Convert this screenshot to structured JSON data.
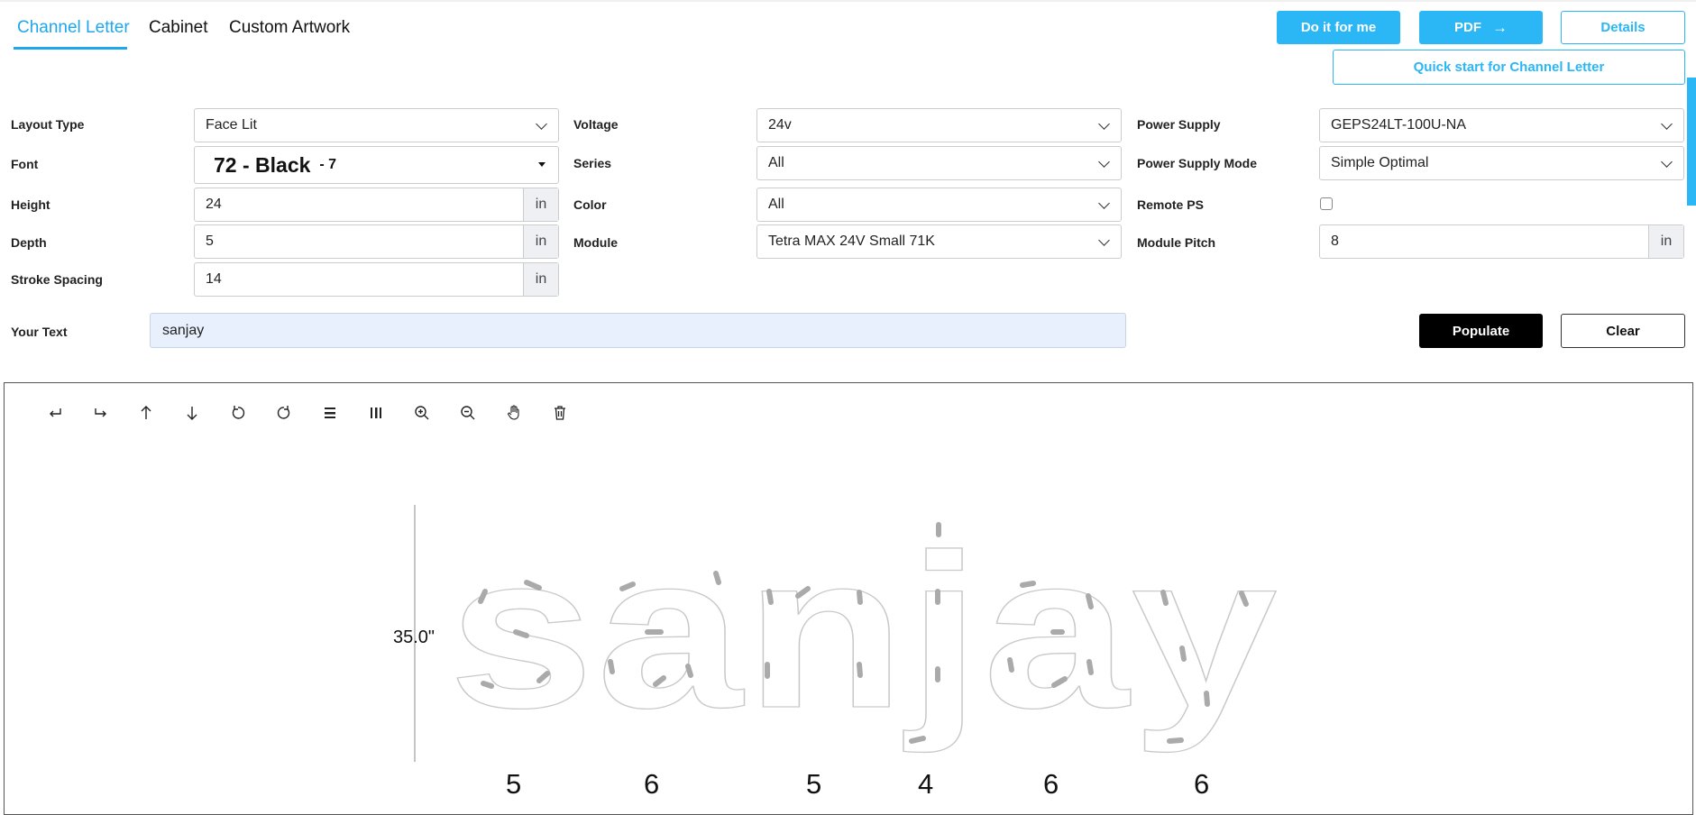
{
  "tabs": [
    {
      "label": "Channel Letter",
      "active": true
    },
    {
      "label": "Cabinet",
      "active": false
    },
    {
      "label": "Custom Artwork",
      "active": false
    }
  ],
  "actions": {
    "do_it_for_me": "Do it for me",
    "pdf": "PDF",
    "pdf_arrow": "→",
    "details": "Details",
    "quick_start": "Quick start for Channel Letter"
  },
  "form": {
    "layout_type": {
      "label": "Layout Type",
      "value": "Face Lit"
    },
    "font": {
      "label": "Font",
      "value": "72 - Black",
      "suffix": "- 7"
    },
    "height": {
      "label": "Height",
      "value": "24",
      "unit": "in"
    },
    "depth": {
      "label": "Depth",
      "value": "5",
      "unit": "in"
    },
    "stroke_spacing": {
      "label": "Stroke Spacing",
      "value": "14",
      "unit": "in"
    },
    "voltage": {
      "label": "Voltage",
      "value": "24v"
    },
    "series": {
      "label": "Series",
      "value": "All"
    },
    "color": {
      "label": "Color",
      "value": "All"
    },
    "module": {
      "label": "Module",
      "value": "Tetra MAX 24V Small 71K"
    },
    "power_supply": {
      "label": "Power Supply",
      "value": "GEPS24LT-100U-NA"
    },
    "power_supply_mode": {
      "label": "Power Supply Mode",
      "value": "Simple Optimal"
    },
    "remote_ps": {
      "label": "Remote PS",
      "checked": false
    },
    "module_pitch": {
      "label": "Module Pitch",
      "value": "8",
      "unit": "in"
    }
  },
  "your_text": {
    "label": "Your Text",
    "value": "sanjay"
  },
  "buttons": {
    "populate": "Populate",
    "clear": "Clear"
  },
  "toolbar": [
    "undo-icon",
    "redo-icon",
    "move-up-icon",
    "move-down-icon",
    "rotate-left-icon",
    "rotate-right-icon",
    "align-horizontal-icon",
    "align-vertical-icon",
    "zoom-in-icon",
    "zoom-out-icon",
    "pan-hand-icon",
    "delete-icon"
  ],
  "preview": {
    "text": "sanjay",
    "height_dimension": "35.0\"",
    "module_counts": [
      "5",
      "6",
      "5",
      "4",
      "6",
      "6"
    ]
  },
  "colors": {
    "accent": "#2bb6f5",
    "active_tab": "#1ea7ec",
    "text_input_bg": "#e8f0fd"
  }
}
